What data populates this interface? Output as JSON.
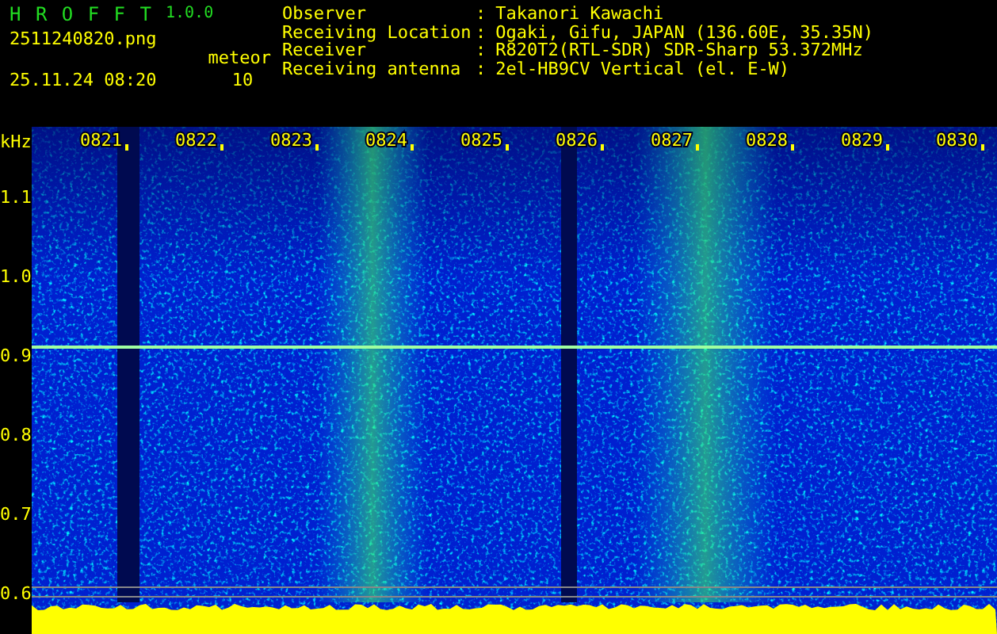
{
  "app": {
    "title": "H R O F F T",
    "version": "1.0.0",
    "filename": "2511240820.png",
    "datetime": "25.11.24 08:20",
    "meteor_label": "meteor",
    "meteor_count": "10"
  },
  "station": [
    {
      "label": "Observer",
      "separator": ":",
      "value": "Takanori Kawachi"
    },
    {
      "label": "Receiving Location",
      "separator": ":",
      "value": "Ogaki, Gifu, JAPAN (136.60E, 35.35N)"
    },
    {
      "label": "Receiver",
      "separator": ":",
      "value": "R820T2(RTL-SDR) SDR-Sharp 53.372MHz"
    },
    {
      "label": "Receiving antenna",
      "separator": ":",
      "value": "2el-HB9CV Vertical (el. E-W)"
    }
  ],
  "spectrogram": {
    "unit": "kHz",
    "frequency_labels": [
      "1.1",
      "1.0",
      "0.9",
      "0.8",
      "0.7",
      "0.6"
    ],
    "time_labels": [
      "0821",
      "0822",
      "0823",
      "0824",
      "0825",
      "0826",
      "0827",
      "0828",
      "0829",
      "0830"
    ]
  }
}
